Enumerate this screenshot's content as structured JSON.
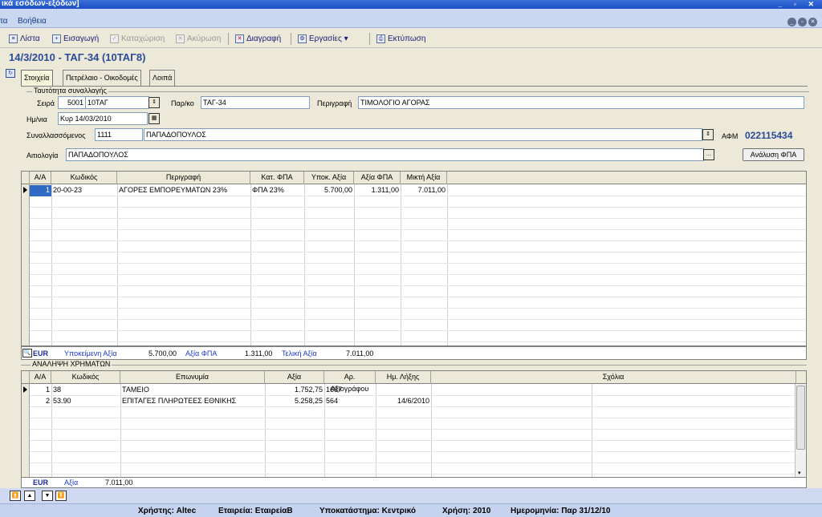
{
  "window": {
    "title": "ικά εσόδων-εξόδων]"
  },
  "menubar": {
    "items": [
      "τα",
      "Βοήθεια"
    ]
  },
  "toolbar": {
    "list": "Λίστα",
    "insert": "Εισαγωγή",
    "post": "Καταχώριση",
    "cancel": "Ακύρωση",
    "delete": "Διαγραφή",
    "tasks": "Εργασίες",
    "print": "Εκτύπωση"
  },
  "doc_title": "14/3/2010 - ΤΑΓ-34 (10ΤΑΓ8)",
  "tabs": [
    "Στοιχεία",
    "Πετρέλαιο - Οικοδομές",
    "Λοιπά"
  ],
  "transaction": {
    "group_title": "Ταυτότητα συναλλαγής",
    "series_label": "Σειρά",
    "series_code": "5001",
    "series_name": "10ΤΑΓ",
    "ref_label": "Παρ/κο",
    "ref_value": "ΤΑΓ-34",
    "desc_label": "Περιγραφή",
    "desc_value": "ΤΙΜΟΛΟΓΙΟ ΑΓΟΡΑΣ",
    "date_label": "Ημ/νια",
    "date_value": "Κυρ 14/03/2010",
    "party_label": "Συναλλασσόμενος",
    "party_code": "1111",
    "party_name": "ΠΑΠΑΔΟΠΟΥΛΟΣ",
    "afm_label": "ΑΦΜ",
    "afm_value": "022115434",
    "reason_label": "Αιτιολογία",
    "reason_value": "ΠΑΠΑΔΟΠΟΥΛΟΣ",
    "vat_button": "Ανάλυση ΦΠΑ"
  },
  "lines_grid": {
    "headers": [
      "Α/Α",
      "Κωδικός",
      "Περιγραφή",
      "Κατ. ΦΠΑ",
      "Υποκ. Αξία",
      "Αξία ΦΠΑ",
      "Μικτή Αξία"
    ],
    "rows": [
      [
        "1",
        "20-00-23",
        "ΑΓΟΡΕΣ ΕΜΠΟΡΕΥΜΑΤΩΝ 23%",
        "ΦΠΑ 23%",
        "5.700,00",
        "1.311,00",
        "7.011,00"
      ]
    ]
  },
  "totals": {
    "currency": "EUR",
    "taxable_label": "Υποκείμενη Αξία",
    "taxable_value": "5.700,00",
    "vat_label": "Αξία ΦΠΑ",
    "vat_value": "1.311,00",
    "final_label": "Τελική Αξία",
    "final_value": "7.011,00"
  },
  "payments": {
    "title": "ΑΝΑΛΗΨΗ ΧΡΗΜΑΤΩΝ",
    "headers": [
      "Α/Α",
      "Κωδικός",
      "Επωνυμία",
      "Αξία",
      "Αρ. Αξιογράφου",
      "Ημ. Λήξης",
      "Σχόλια"
    ],
    "rows": [
      [
        "1",
        "38",
        "ΤΑΜΕΙΟ",
        "1.752,75",
        "1687",
        "",
        ""
      ],
      [
        "2",
        "53.90",
        "ΕΠΙΤΑΓΕΣ ΠΛΗΡΩΤΕΕΣ ΕΘΝΙΚΗΣ",
        "5.258,25",
        "564",
        "14/6/2010",
        ""
      ]
    ],
    "total_currency": "EUR",
    "total_label": "Αξία",
    "total_value": "7.011,00"
  },
  "statusbar": {
    "user": "Χρήστης: Altec",
    "company": "Εταιρεία: ΕταιρείαΒ",
    "branch": "Υποκατάστημα: Κεντρικό",
    "year": "Χρήση: 2010",
    "date": "Ημερομηνία: Παρ 31/12/10"
  }
}
